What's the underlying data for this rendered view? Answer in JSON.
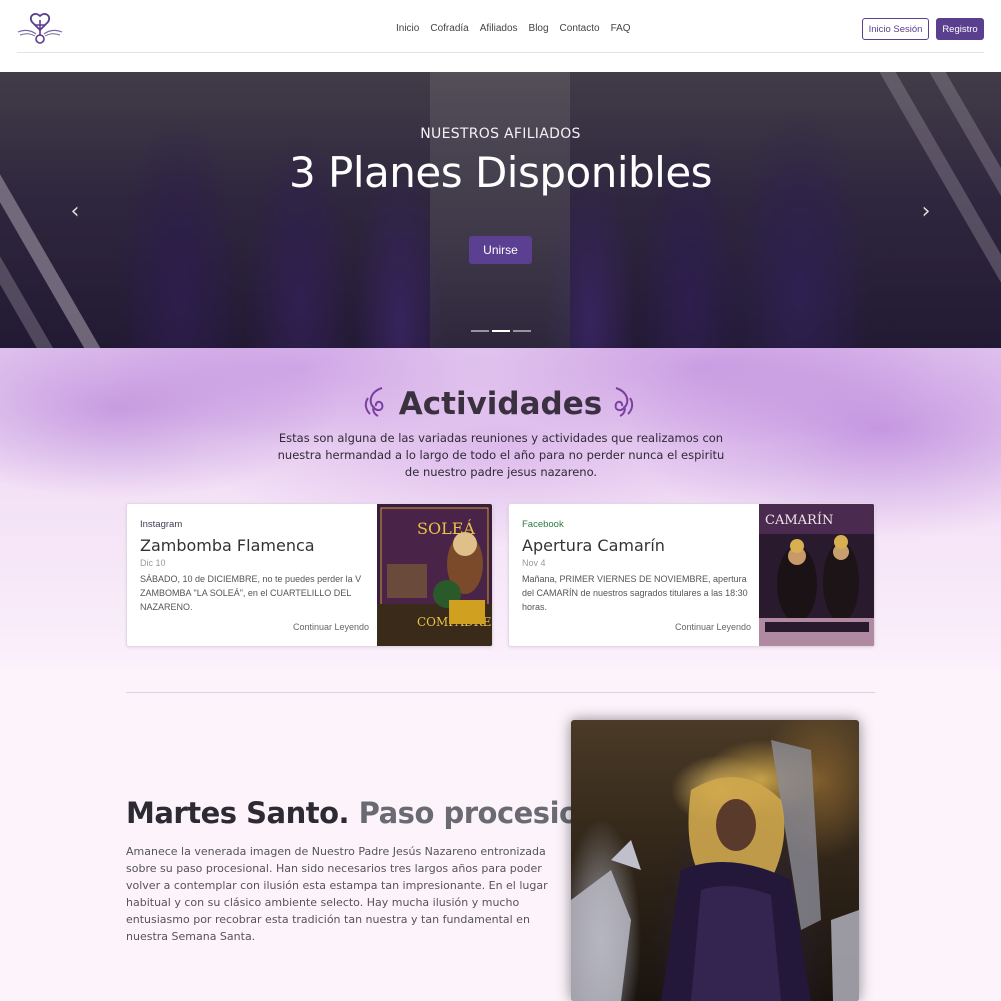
{
  "nav": {
    "links": [
      "Inicio",
      "Cofradía",
      "Afiliados",
      "Blog",
      "Contacto",
      "FAQ"
    ],
    "login_label": "Inicio Sesión",
    "register_label": "Registro"
  },
  "hero": {
    "kicker": "NUESTROS AFILIADOS",
    "title": "3 Planes Disponibles",
    "button_label": "Unirse",
    "active_slide": 2,
    "slide_count": 3
  },
  "activities": {
    "title": "Actividades",
    "description": "Estas son alguna de las variadas reuniones y actividades que realizamos con nuestra hermandad a lo largo de todo el año para no perder nunca el espiritu de nuestro padre jesus nazareno.",
    "cards": [
      {
        "source": "Instagram",
        "title": "Zambomba Flamenca",
        "date": "Dic 10",
        "text": "SÁBADO, 10 de DICIEMBRE, no te puedes perder la V ZAMBOMBA \"LA SOLEÁ\", en el CUARTELILLO DEL NAZARENO.",
        "more_label": "Continuar Leyendo"
      },
      {
        "source": "Facebook",
        "title": "Apertura Camarín",
        "date": "Nov 4",
        "text": "Mañana, PRIMER VIERNES DE NOVIEMBRE, apertura del CAMARÍN de nuestros sagrados titulares a las 18:30 horas.",
        "more_label": "Continuar Leyendo"
      }
    ]
  },
  "feature": {
    "heading_main": "Martes Santo.",
    "heading_muted": "Paso procesional.",
    "text": "Amanece la venerada imagen de Nuestro Padre Jesús Nazareno entronizada sobre su paso procesional. Han sido necesarios tres largos años para poder volver a contemplar con ilusión esta estampa tan impresionante. En el lugar habitual y con su clásico ambiente selecto. Hay mucha ilusión y mucho entusiasmo por recobrar esta tradición tan nuestra y tan fundamental en nuestra Semana Santa."
  },
  "colors": {
    "accent": "#5a3f8f",
    "facebook_green": "#2c7a3f"
  }
}
